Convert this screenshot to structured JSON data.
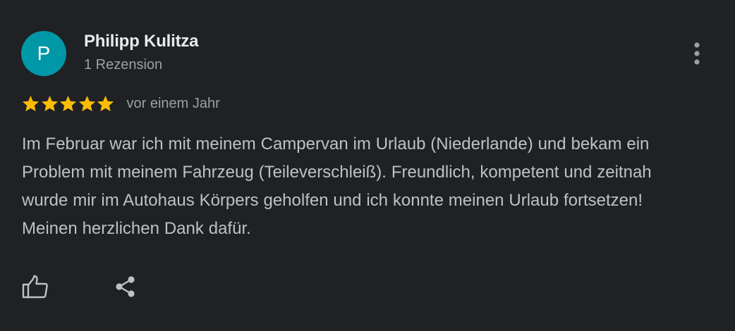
{
  "review": {
    "author": {
      "initial": "P",
      "name": "Philipp Kulitza",
      "meta": "1 Rezension"
    },
    "rating": 5,
    "rating_max": 5,
    "date": "vor einem Jahr",
    "text": "Im Februar war ich mit meinem Campervan im Urlaub (Niederlande) und bekam ein Problem mit meinem Fahrzeug (Teileverschleiß). Freundlich, kompetent und zeitnah wurde mir im Autohaus Körpers geholfen und ich konnte meinen Urlaub fortsetzen! Meinen herzlichen Dank dafür."
  },
  "icons": {
    "more": "more-vert-icon",
    "like": "thumb-up-icon",
    "share": "share-icon",
    "star": "star-icon"
  },
  "colors": {
    "background": "#202124",
    "avatar": "#0097a7",
    "star": "#fbbc04",
    "primary_text": "#e8eaed",
    "secondary_text": "#9aa0a6",
    "body_text": "#bdc1c6"
  }
}
